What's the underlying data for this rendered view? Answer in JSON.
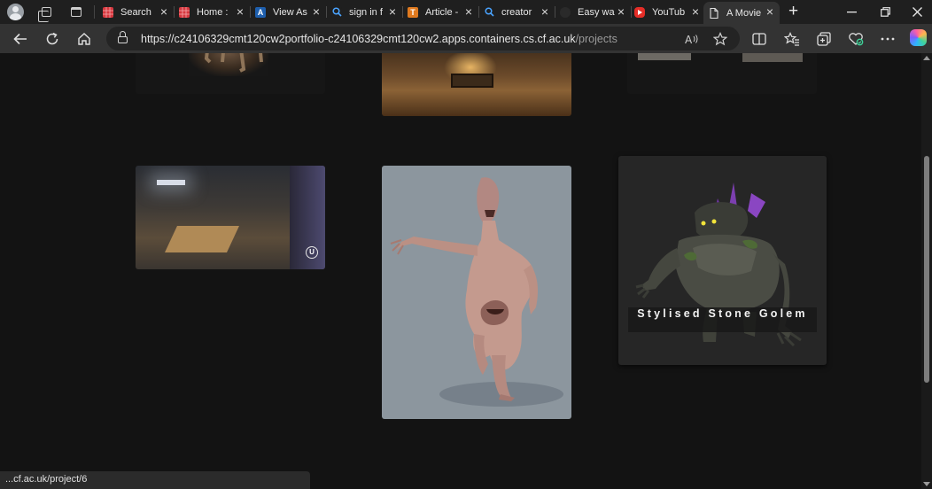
{
  "tabs": [
    {
      "title": "Search",
      "favicon": "grid-red-icon",
      "color": "#d7383f"
    },
    {
      "title": "Home :",
      "favicon": "grid-red-icon",
      "color": "#d7383f"
    },
    {
      "title": "View As",
      "favicon": "a-letter-icon",
      "color": "#1e5fae"
    },
    {
      "title": "sign in f",
      "favicon": "search-icon",
      "color": "#1f1f1f"
    },
    {
      "title": "Article -",
      "favicon": "t-letter-icon",
      "color": "#e07a1f"
    },
    {
      "title": "creator",
      "favicon": "search-icon",
      "color": "#1f1f1f"
    },
    {
      "title": "Easy wa",
      "favicon": "dark-circle-icon",
      "color": "#2a2a2a"
    },
    {
      "title": "YouTub",
      "favicon": "youtube-icon",
      "color": "#e52d27"
    },
    {
      "title": "A Movie",
      "favicon": "page-icon",
      "color": "#333333",
      "active": true
    }
  ],
  "address_bar": {
    "url_host": "https://c24106329cmt120cw2portfolio-c24106329cmt120cw2.apps.containers.cs.cf.ac.uk",
    "url_path": "/projects"
  },
  "projects": {
    "card_golem_title": "Stylised Stone Golem"
  },
  "status_bar": {
    "link_preview": "...cf.ac.uk/project/6"
  },
  "colors": {
    "page_background": "#131313",
    "tab_strip": "#1f1f1f",
    "toolbar": "#333333"
  }
}
